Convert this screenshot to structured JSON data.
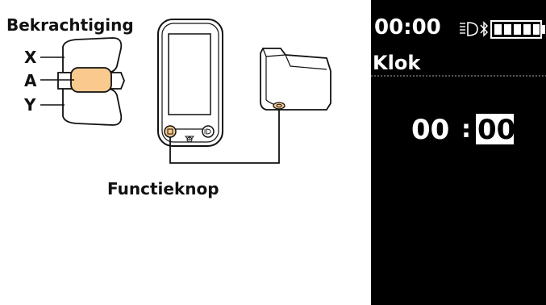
{
  "labels": {
    "bekrachtiging": "Bekrachtiging",
    "x": "X",
    "a": "A",
    "y": "Y",
    "functieknop": "Functieknop"
  },
  "display": {
    "status_time": "00:00",
    "menu_title": "Klok",
    "clock_hours": "00",
    "clock_separator": ":",
    "clock_minutes": "00"
  },
  "colors": {
    "button_a_highlight": "#F9C98E",
    "function_button_highlight": "#F9C98E",
    "screen_background": "#000000",
    "screen_text": "#FFFFFF"
  },
  "icons": [
    "headlight-icon",
    "bluetooth-icon",
    "battery-icon",
    "power-icon",
    "light-button-icon"
  ]
}
